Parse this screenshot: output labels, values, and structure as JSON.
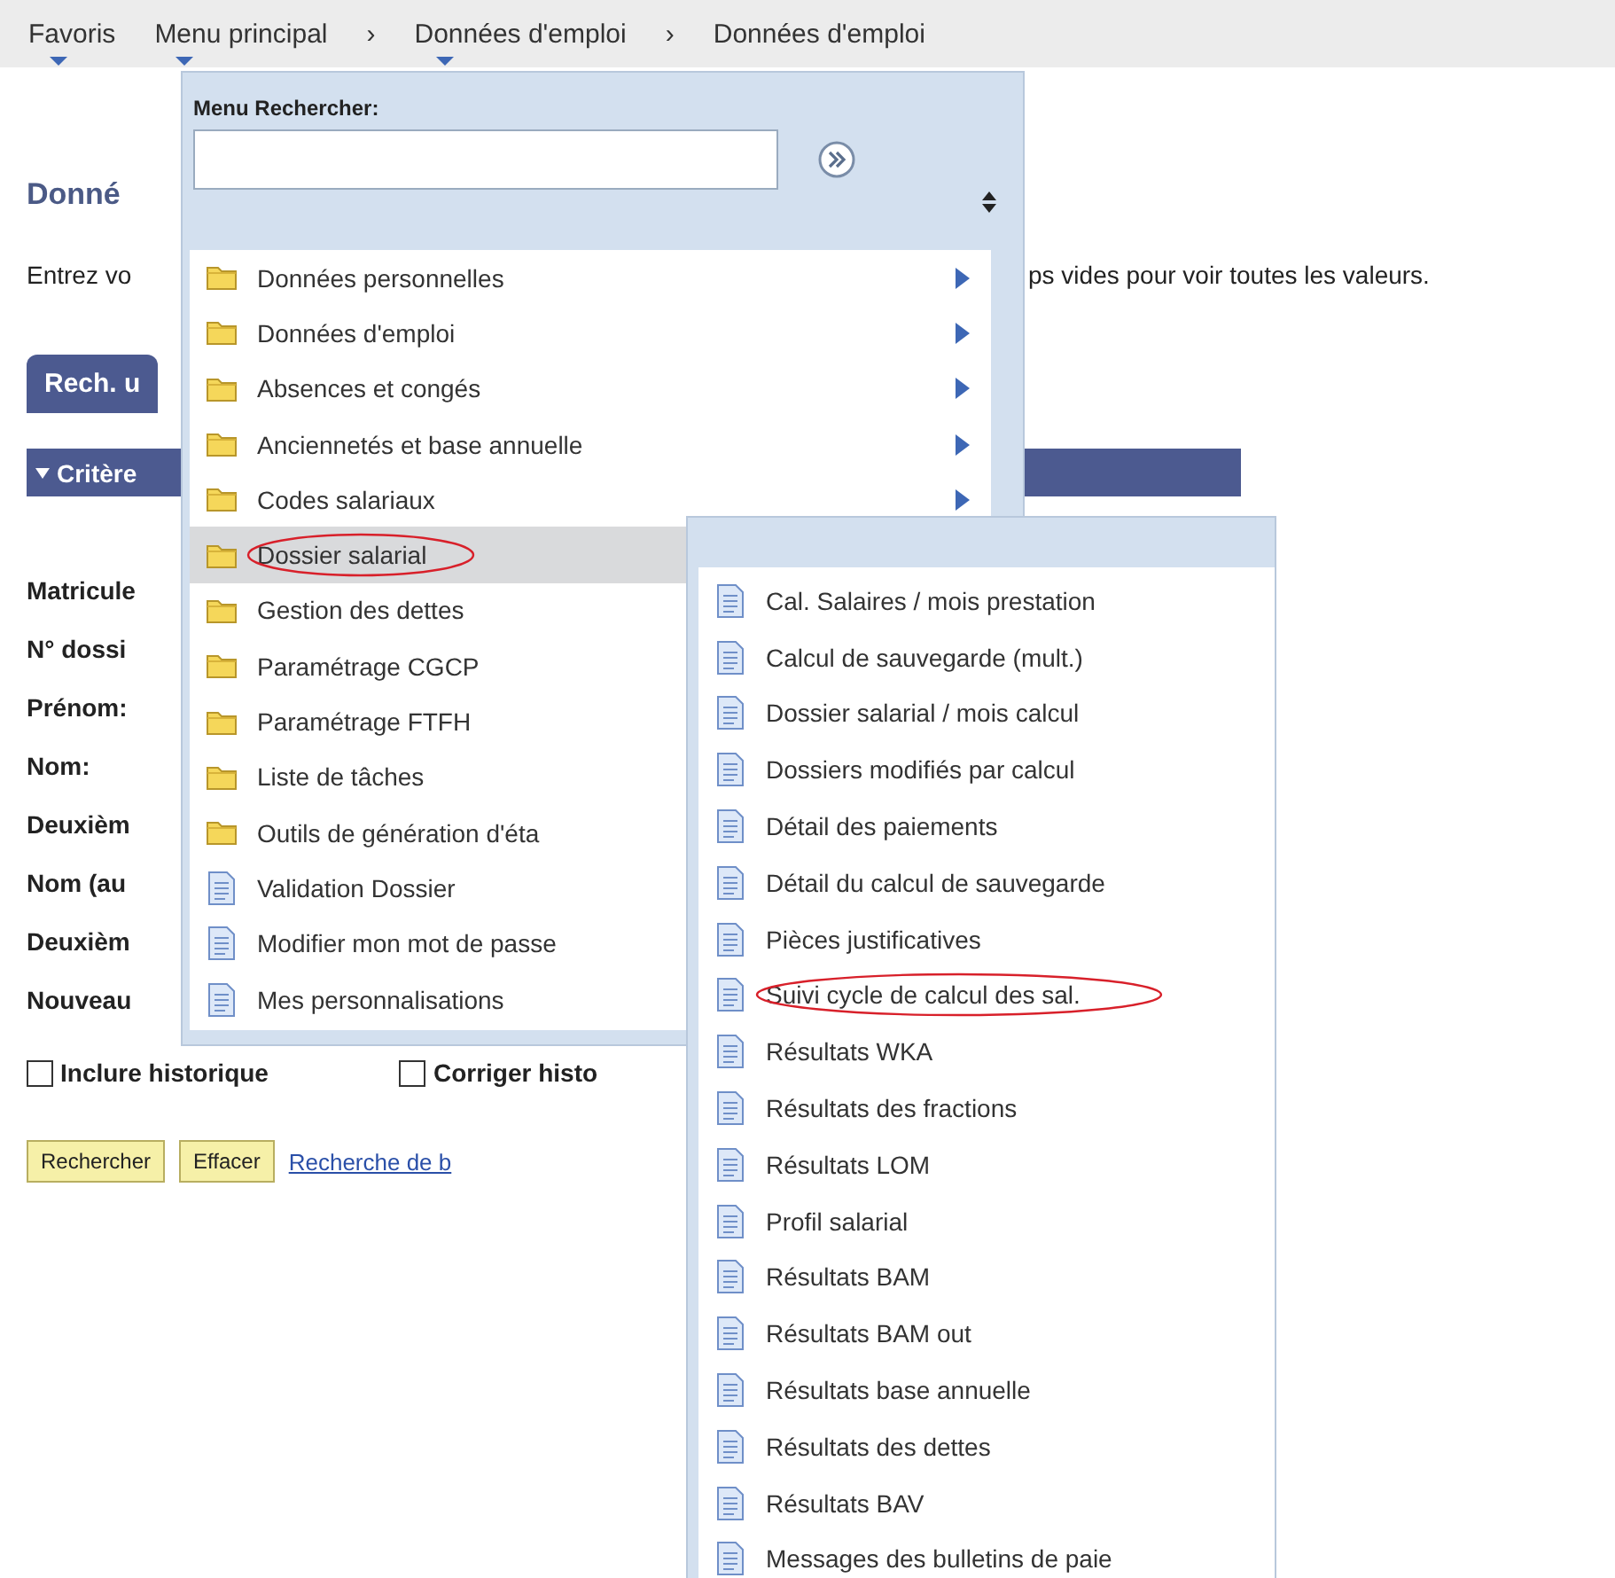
{
  "breadcrumb": [
    {
      "kind": "link",
      "label": "Favoris",
      "dropdown": true
    },
    {
      "kind": "link",
      "label": "Menu principal",
      "dropdown": true
    },
    {
      "kind": "separator",
      "label": "›"
    },
    {
      "kind": "link",
      "label": "Données d'emploi",
      "dropdown": true
    },
    {
      "kind": "separator",
      "label": "›"
    },
    {
      "kind": "link",
      "label": "Données d'emploi",
      "dropdown": false
    }
  ],
  "page": {
    "title": "Donné",
    "instruction_left": "Entrez vo",
    "instruction_right": "ps vides pour voir toutes les valeurs.",
    "tab": {
      "label": "Rech. u",
      "selected": true
    },
    "section": {
      "label": "Critère",
      "expanded": true
    },
    "fields": [
      "Matricule",
      "N° dossi",
      "Prénom:",
      "Nom:",
      "Deuxièm",
      "Nom (au",
      "Deuxièm",
      "Nouveau"
    ],
    "checkboxes": [
      {
        "label": "Inclure historique",
        "checked": false
      },
      {
        "label": "Corriger histo",
        "checked": false
      }
    ],
    "buttons": [
      {
        "kind": "button",
        "label": "Rechercher"
      },
      {
        "kind": "button",
        "label": "Effacer"
      },
      {
        "kind": "link",
        "label": "Recherche de b"
      }
    ]
  },
  "menu": {
    "search_label": "Menu Rechercher:",
    "items": [
      {
        "kind": "folder",
        "label": "Données personnelles",
        "submenu": true,
        "selected": false,
        "circled": false
      },
      {
        "kind": "folder",
        "label": "Données d'emploi",
        "submenu": true,
        "selected": false,
        "circled": false
      },
      {
        "kind": "folder",
        "label": "Absences et congés",
        "submenu": true,
        "selected": false,
        "circled": false
      },
      {
        "kind": "folder",
        "label": "Anciennetés et base annuelle",
        "submenu": true,
        "selected": false,
        "circled": false
      },
      {
        "kind": "folder",
        "label": "Codes salariaux",
        "submenu": true,
        "selected": false,
        "circled": false
      },
      {
        "kind": "folder",
        "label": "Dossier salarial",
        "submenu": false,
        "selected": true,
        "circled": true
      },
      {
        "kind": "folder",
        "label": "Gestion des dettes",
        "submenu": false,
        "selected": false,
        "circled": false
      },
      {
        "kind": "folder",
        "label": "Paramétrage CGCP",
        "submenu": false,
        "selected": false,
        "circled": false
      },
      {
        "kind": "folder",
        "label": "Paramétrage FTFH",
        "submenu": false,
        "selected": false,
        "circled": false
      },
      {
        "kind": "folder",
        "label": "Liste de tâches",
        "submenu": false,
        "selected": false,
        "circled": false
      },
      {
        "kind": "folder",
        "label": "Outils de génération d'éta",
        "submenu": false,
        "selected": false,
        "circled": false
      },
      {
        "kind": "page",
        "label": "Validation Dossier",
        "submenu": false,
        "selected": false,
        "circled": false
      },
      {
        "kind": "page",
        "label": "Modifier mon mot de passe",
        "submenu": false,
        "selected": false,
        "circled": false
      },
      {
        "kind": "page",
        "label": "Mes personnalisations",
        "submenu": false,
        "selected": false,
        "circled": false
      }
    ]
  },
  "submenu": {
    "items": [
      {
        "kind": "page",
        "label": "Cal. Salaires / mois prestation",
        "circled": false
      },
      {
        "kind": "page",
        "label": "Calcul de sauvegarde (mult.)",
        "circled": false
      },
      {
        "kind": "page",
        "label": "Dossier salarial / mois calcul",
        "circled": false
      },
      {
        "kind": "page",
        "label": "Dossiers modifiés par calcul",
        "circled": false
      },
      {
        "kind": "page",
        "label": "Détail des paiements",
        "circled": false
      },
      {
        "kind": "page",
        "label": "Détail du calcul de sauvegarde",
        "circled": false
      },
      {
        "kind": "page",
        "label": "Pièces justificatives",
        "circled": false
      },
      {
        "kind": "page",
        "label": "Suivi cycle de calcul des sal.",
        "circled": true
      },
      {
        "kind": "page",
        "label": "Résultats WKA",
        "circled": false
      },
      {
        "kind": "page",
        "label": "Résultats des fractions",
        "circled": false
      },
      {
        "kind": "page",
        "label": "Résultats LOM",
        "circled": false
      },
      {
        "kind": "page",
        "label": "Profil salarial",
        "circled": false
      },
      {
        "kind": "page",
        "label": "Résultats BAM",
        "circled": false
      },
      {
        "kind": "page",
        "label": "Résultats BAM out",
        "circled": false
      },
      {
        "kind": "page",
        "label": "Résultats base annuelle",
        "circled": false
      },
      {
        "kind": "page",
        "label": "Résultats des dettes",
        "circled": false
      },
      {
        "kind": "page",
        "label": "Résultats BAV",
        "circled": false
      },
      {
        "kind": "page",
        "label": "Messages des bulletins de paie",
        "circled": false
      }
    ]
  }
}
